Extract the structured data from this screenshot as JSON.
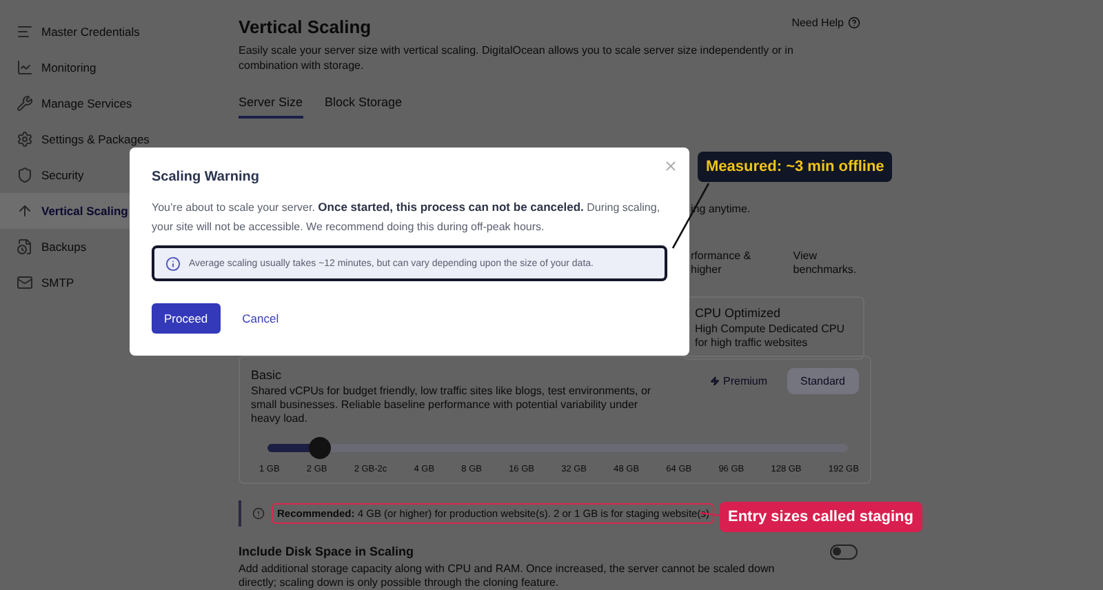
{
  "sidebar": {
    "items": [
      {
        "label": "Master Credentials",
        "selected": false
      },
      {
        "label": "Monitoring",
        "selected": false
      },
      {
        "label": "Manage Services",
        "selected": false
      },
      {
        "label": "Settings & Packages",
        "selected": false
      },
      {
        "label": "Security",
        "selected": false
      },
      {
        "label": "Vertical Scaling",
        "selected": true
      },
      {
        "label": "Backups",
        "selected": false
      },
      {
        "label": "SMTP",
        "selected": false
      }
    ]
  },
  "page": {
    "title": "Vertical Scaling",
    "description": "Easily scale your server size with vertical scaling. DigitalOcean allows you to scale server size independently or in combination with storage.",
    "help_link": "Need Help"
  },
  "tabs": [
    {
      "label": "Server Size",
      "selected": true
    },
    {
      "label": "Block Storage",
      "selected": false
    }
  ],
  "server_size": {
    "note_tail": "ing anytime.",
    "tier_tail": "rformance & higher",
    "benchmarks_link": "View benchmarks.",
    "cpu_optimized": {
      "title": "CPU Optimized",
      "description": "High Compute Dedicated CPU for high traffic websites"
    },
    "basic": {
      "title": "Basic",
      "description": "Shared vCPUs for budget friendly, low traffic sites like blogs, test environments, or small businesses. Reliable baseline performance with potential variability under heavy load.",
      "options": [
        {
          "label": "Premium",
          "selected": false
        },
        {
          "label": "Standard",
          "selected": true
        }
      ],
      "slider": {
        "level": 0.09,
        "ticks": [
          "1 GB",
          "2 GB",
          "2 GB-2c",
          "4 GB",
          "8 GB",
          "16 GB",
          "32 GB",
          "48 GB",
          "64 GB",
          "96 GB",
          "128 GB",
          "192 GB"
        ]
      }
    },
    "recommendation": {
      "text": "**Recommended:** 4 GB (or higher) for production website(s). 2 or 1 GB is for staging website(s)",
      "highlighted": true
    },
    "disk": {
      "title": "Include Disk Space in Scaling",
      "description": "Add additional storage capacity along with CPU and RAM. Once increased, the server cannot be scaled down directly; scaling down is only possible through the cloning feature.",
      "on": false
    }
  },
  "modal": {
    "title": "Scaling Warning",
    "message": "You’re about to scale your server. **Once started, this process can not be canceled.** During scaling, your site will not be accessible. We recommend doing this during off-peak hours.",
    "info": {
      "text": "Average scaling usually takes ~12 minutes, but can vary depending upon the size of your data.",
      "highlighted": true
    },
    "buttons": [
      {
        "label": "Proceed",
        "kind": "primary"
      },
      {
        "label": "Cancel",
        "kind": "link"
      }
    ]
  },
  "annotations": [
    {
      "text": "Measured: ~3 min offline",
      "kind": "dark"
    },
    {
      "text": "Entry sizes called staging",
      "kind": "red"
    }
  ]
}
